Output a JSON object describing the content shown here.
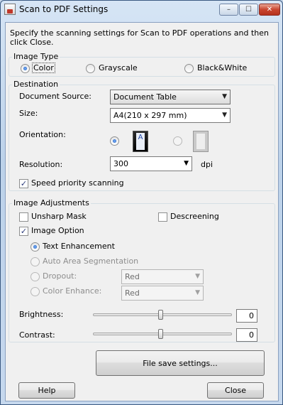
{
  "window": {
    "title": "Scan to PDF Settings"
  },
  "titlebar": {
    "min": "–",
    "max": "☐",
    "close": "✕"
  },
  "intro": "Specify the scanning settings for Scan to PDF operations and then click Close.",
  "image_type": {
    "title": "Image Type",
    "options": [
      "Color",
      "Grayscale",
      "Black&White"
    ],
    "selected": "Color"
  },
  "destination": {
    "title": "Destination",
    "document_source_label": "Document Source:",
    "document_source_value": "Document Table",
    "size_label": "Size:",
    "size_value": "A4(210 x 297 mm)",
    "orientation_label": "Orientation:",
    "orientation_selected": "portrait",
    "resolution_label": "Resolution:",
    "resolution_value": "300",
    "resolution_unit": "dpi",
    "speed_priority_label": "Speed priority scanning",
    "speed_priority_checked": true
  },
  "image_adjustments": {
    "title": "Image Adjustments",
    "unsharp_mask_label": "Unsharp Mask",
    "unsharp_mask_checked": false,
    "descreening_label": "Descreening",
    "descreening_checked": false,
    "image_option_label": "Image Option",
    "image_option_checked": true,
    "text_enhancement_label": "Text Enhancement",
    "auto_area_label": "Auto Area Segmentation",
    "dropout_label": "Dropout:",
    "dropout_value": "Red",
    "color_enhance_label": "Color Enhance:",
    "color_enhance_value": "Red",
    "brightness_label": "Brightness:",
    "brightness_value": "0",
    "contrast_label": "Contrast:",
    "contrast_value": "0"
  },
  "buttons": {
    "file_save": "File save settings...",
    "help": "Help",
    "close": "Close"
  },
  "glyphs": {
    "check": "✓",
    "dropdown": "▼"
  }
}
